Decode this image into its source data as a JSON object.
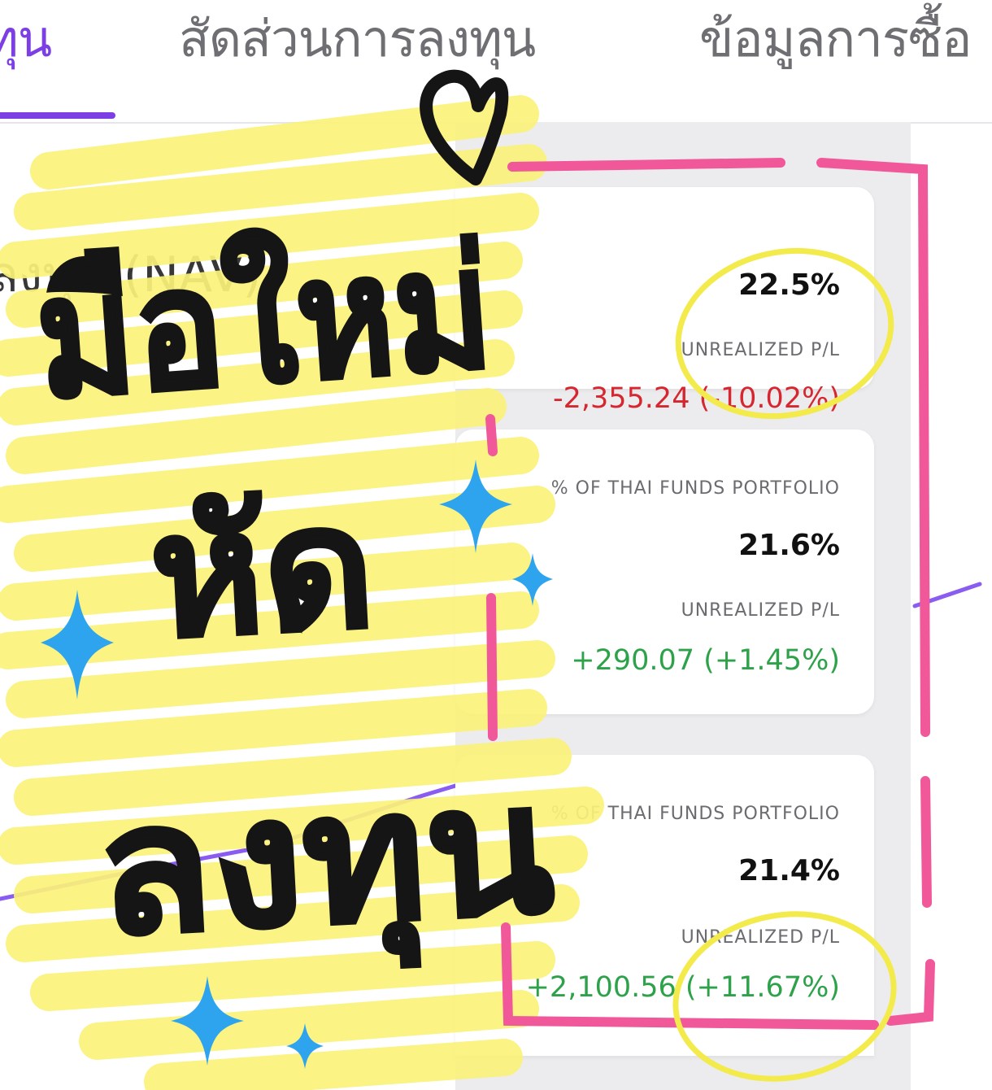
{
  "tabs": [
    {
      "label": "ทุน",
      "active": true
    },
    {
      "label": "สัดส่วนการลงทุน",
      "active": false
    },
    {
      "label": "ข้อมูลการซื้อ",
      "active": false
    }
  ],
  "left": {
    "nav_label": "ลงทุน (NAV)"
  },
  "cards": [
    {
      "caption": "",
      "percent": "22.5%",
      "pl_label": "UNREALIZED P/L",
      "pl_value": "-2,355.24 (-10.02%)",
      "pl_sign": "negative"
    },
    {
      "caption": "% OF THAI FUNDS PORTFOLIO",
      "percent": "21.6%",
      "pl_label": "UNREALIZED P/L",
      "pl_value": "+290.07 (+1.45%)",
      "pl_sign": "positive"
    },
    {
      "caption": "% OF THAI FUNDS PORTFOLIO",
      "percent": "21.4%",
      "pl_label": "UNREALIZED P/L",
      "pl_value": "+2,100.56 (+11.67%)",
      "pl_sign": "positive"
    }
  ],
  "sticker": {
    "line1": "มือใหม่",
    "line2": "หัด",
    "line3": "ลงทุน"
  },
  "colors": {
    "accent": "#7b3fe4",
    "negative": "#d6262f",
    "positive": "#2ea24a",
    "highlighter": "#fbf27a",
    "frame": "#f0589a",
    "circle": "#f3ea4b",
    "sparkle": "#2ea4ee"
  },
  "icons": [
    "heart-doodle-icon",
    "sparkle-icon"
  ]
}
